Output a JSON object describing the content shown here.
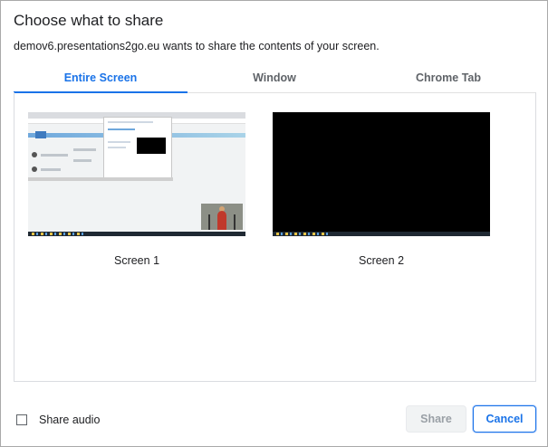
{
  "dialog": {
    "title": "Choose what to share",
    "subtitle": "demov6.presentations2go.eu wants to share the contents of your screen."
  },
  "tabs": [
    {
      "label": "Entire Screen",
      "active": true
    },
    {
      "label": "Window",
      "active": false
    },
    {
      "label": "Chrome Tab",
      "active": false
    }
  ],
  "sources": [
    {
      "label": "Screen 1"
    },
    {
      "label": "Screen 2"
    }
  ],
  "footer": {
    "share_audio_label": "Share audio",
    "share_audio_checked": false,
    "share_label": "Share",
    "cancel_label": "Cancel"
  },
  "colors": {
    "accent": "#1a73e8"
  }
}
